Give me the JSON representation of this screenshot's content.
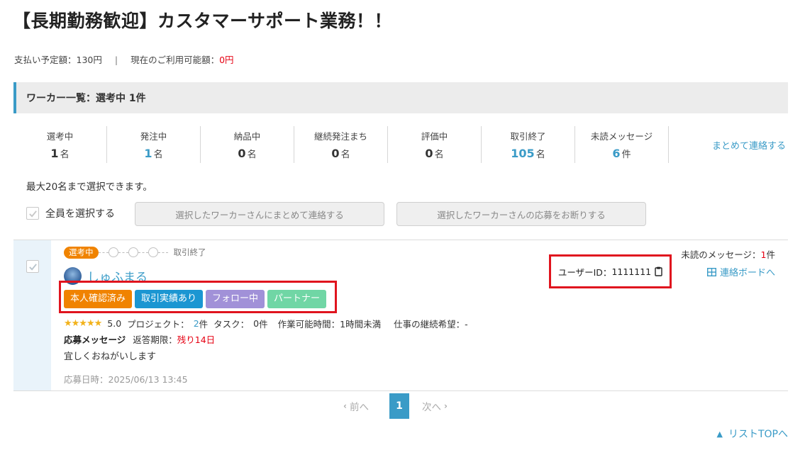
{
  "page": {
    "title": "【長期勤務歓迎】カスタマーサポート業務！！"
  },
  "budget": {
    "planned_label": "支払い予定額：",
    "planned_value": "130円",
    "separator": "|",
    "available_label": "現在のご利用可能額：",
    "available_value": "0円"
  },
  "list_header": {
    "title": "ワーカー一覧：選考中 1件"
  },
  "stats": [
    {
      "label": "選考中",
      "value": "1",
      "unit": "名",
      "highlight": false
    },
    {
      "label": "発注中",
      "value": "1",
      "unit": "名",
      "highlight": true
    },
    {
      "label": "納品中",
      "value": "0",
      "unit": "名",
      "highlight": false
    },
    {
      "label": "継続発注まち",
      "value": "0",
      "unit": "名",
      "highlight": false
    },
    {
      "label": "評価中",
      "value": "0",
      "unit": "名",
      "highlight": false
    },
    {
      "label": "取引終了",
      "value": "105",
      "unit": "名",
      "highlight": true
    },
    {
      "label": "未読メッセージ",
      "value": "6",
      "unit": "件",
      "highlight": true
    }
  ],
  "actions": {
    "contact_all": "まとめて連絡する",
    "max_note": "最大20名まで選択できます。",
    "select_all": "全員を選択する",
    "contact_selected": "選択したワーカーさんにまとめて連絡する",
    "decline_selected": "選択したワーカーさんの応募をお断りする"
  },
  "worker": {
    "status": "選考中",
    "progress_end": "取引終了",
    "name": "しゅふまる",
    "badges": [
      "本人確認済み",
      "取引実績あり",
      "フォロー中",
      "パートナー"
    ],
    "stars": "★★★★★",
    "rating": "5.0",
    "project_label": "プロジェクト：",
    "project_count": "2",
    "task_label": "タスク：",
    "task_count": "0",
    "count_unit": "件",
    "work_hours": "作業可能時間：1時間未満",
    "continuation": "仕事の継続希望：-",
    "apply_message_label": "応募メッセージ",
    "deadline_label": "返答期限：",
    "deadline_value": "残り14日",
    "apply_message": "宜しくおねがいします",
    "apply_date": "応募日時：2025/06/13 13:45",
    "user_id_label": "ユーザーID：",
    "user_id": "1111111",
    "unread_label": "未読のメッセージ：",
    "unread_count": "1",
    "unread_unit": "件",
    "board_link": "連絡ボードへ"
  },
  "pagination": {
    "prev": "前へ",
    "current": "1",
    "next": "次へ"
  },
  "footer": {
    "list_top": "リストTOPへ"
  },
  "colors": {
    "accent_blue": "#3a9bc7",
    "alert_red": "#e60012",
    "highlight_box": "#e0141e",
    "badge_orange": "#f08300",
    "badge_blue": "#1b96d2",
    "badge_purple": "#a191d8",
    "badge_green": "#70d6a5"
  }
}
